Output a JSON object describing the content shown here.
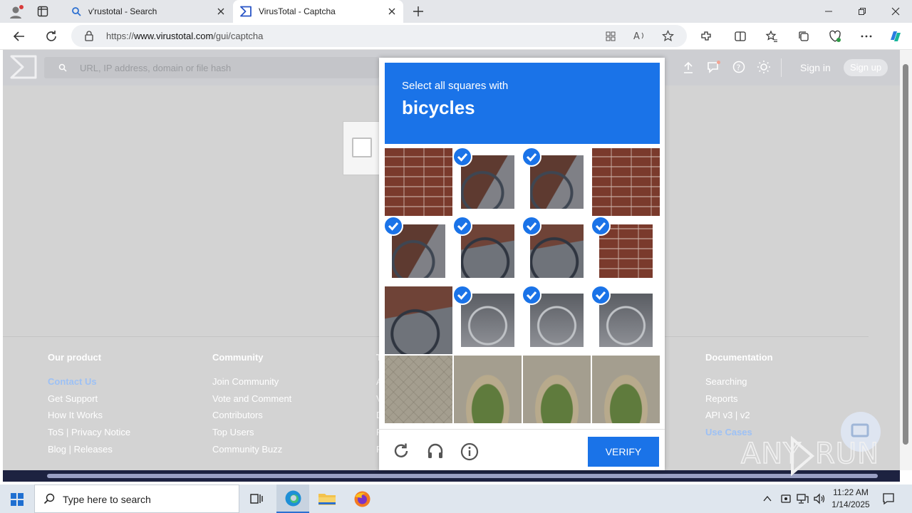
{
  "browser": {
    "tabs": [
      {
        "label": "v'rustotal - Search",
        "icon": "bing-search-icon"
      },
      {
        "label": "VirusTotal - Captcha",
        "icon": "virustotal-icon",
        "active": true
      }
    ],
    "url_prefix": "https://",
    "url_host": "www.virustotal.com",
    "url_path": "/gui/captcha"
  },
  "vt": {
    "search_placeholder": "URL, IP address, domain or file hash",
    "sign_in": "Sign in",
    "sign_up": "Sign up"
  },
  "footer": {
    "col1": {
      "title": "Our product",
      "items": [
        "Contact Us",
        "Get Support",
        "How It Works",
        "ToS | Privacy Notice",
        "Blog | Releases"
      ]
    },
    "col2": {
      "title": "Community",
      "items": [
        "Join Community",
        "Vote and Comment",
        "Contributors",
        "Top Users",
        "Community Buzz"
      ]
    },
    "col3": {
      "title": "T",
      "items": [
        "A",
        "V",
        "D",
        "F",
        "F"
      ]
    },
    "col4": {
      "title": "Documentation",
      "items": [
        "Searching",
        "Reports",
        "API v3 | v2",
        "Use Cases"
      ]
    }
  },
  "captcha": {
    "instruction": "Select all squares with",
    "target": "bicycles",
    "verify_label": "VERIFY",
    "tiles": [
      {
        "selected": false,
        "content": "brick"
      },
      {
        "selected": true,
        "content": "bike"
      },
      {
        "selected": true,
        "content": "bike"
      },
      {
        "selected": false,
        "content": "brick"
      },
      {
        "selected": true,
        "content": "bike"
      },
      {
        "selected": true,
        "content": "bikefull"
      },
      {
        "selected": true,
        "content": "bikefull"
      },
      {
        "selected": true,
        "content": "brick"
      },
      {
        "selected": false,
        "content": "bikefull"
      },
      {
        "selected": true,
        "content": "rack"
      },
      {
        "selected": true,
        "content": "rack"
      },
      {
        "selected": true,
        "content": "rack"
      },
      {
        "selected": false,
        "content": "pave"
      },
      {
        "selected": false,
        "content": "planter"
      },
      {
        "selected": false,
        "content": "planter"
      },
      {
        "selected": false,
        "content": "planter"
      }
    ]
  },
  "watermark": "ANY RUN",
  "taskbar": {
    "search_placeholder": "Type here to search",
    "time": "11:22 AM",
    "date": "1/14/2025"
  },
  "colors": {
    "accent": "#1a73e8",
    "footer_link": "#9dc1f5"
  }
}
